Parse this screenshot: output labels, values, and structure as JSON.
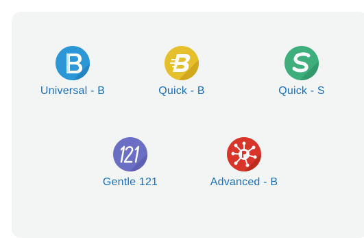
{
  "apps": [
    {
      "label": "Universal - B",
      "icon": "universal-b-icon",
      "color": "#2b97d6"
    },
    {
      "label": "Quick - B",
      "icon": "quick-b-icon",
      "color": "#e6bf2c"
    },
    {
      "label": "Quick - S",
      "icon": "quick-s-icon",
      "color": "#3fae7d"
    },
    {
      "label": "Gentle 121",
      "icon": "gentle-121-icon",
      "color": "#6b6fc4"
    },
    {
      "label": "Advanced - B",
      "icon": "advanced-b-icon",
      "color": "#d8352a"
    }
  ],
  "label_color": "#1a6fb8"
}
